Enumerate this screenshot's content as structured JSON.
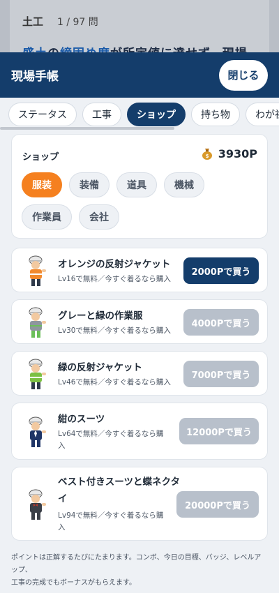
{
  "background": {
    "subject": "土工",
    "counter": "1 / 97 問",
    "question_pre": "",
    "question_hl1": "盛土",
    "question_mid1": "の",
    "question_hl2": "締固め度",
    "question_post": "が所定値に達せず、現場"
  },
  "header": {
    "title": "現場手帳",
    "close_label": "閉じる"
  },
  "tabs": [
    "ステータス",
    "工事",
    "ショップ",
    "持ち物",
    "わが社"
  ],
  "active_tab": "ショップ",
  "shop": {
    "label": "ショップ",
    "points": "3930P",
    "categories": [
      "服装",
      "装備",
      "道具",
      "機械",
      "作業員",
      "会社"
    ],
    "active_category": "服装"
  },
  "items": [
    {
      "name": "オレンジの反射ジャケット",
      "desc": "Lv16で無料／今すぐ着るなら購入",
      "price_label": "2000Pで買う",
      "affordable": true,
      "outfit": "#f28a2e"
    },
    {
      "name": "グレーと緑の作業服",
      "desc": "Lv30で無料／今すぐ着るなら購入",
      "price_label": "4000Pで買う",
      "affordable": false,
      "outfit": "#8e969e"
    },
    {
      "name": "緑の反射ジャケット",
      "desc": "Lv46で無料／今すぐ着るなら購入",
      "price_label": "7000Pで買う",
      "affordable": false,
      "outfit": "#7cc043"
    },
    {
      "name": "紺のスーツ",
      "desc_line1": "Lv64で無料／今すぐ着るなら購",
      "desc_line2": "入",
      "price_label": "12000Pで買う",
      "affordable": false,
      "outfit": "#1f3566"
    },
    {
      "name_line1": "ベスト付きスーツと蝶ネクタ",
      "name_line2": "イ",
      "desc_line1": "Lv94で無料／今すぐ着るなら購",
      "desc_line2": "入",
      "price_label": "20000Pで買う",
      "affordable": false,
      "outfit": "#3a3f47"
    }
  ],
  "footer_note_line1": "ポイントは正解するたびにたまります。コンボ、今日の目標、バッジ、レベルアップ、",
  "footer_note_line2": "工事の完成でもボーナスがもらえます。"
}
